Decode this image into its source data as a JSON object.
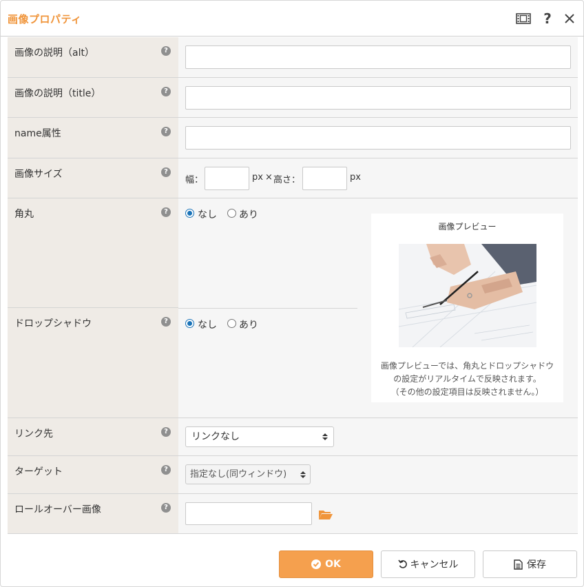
{
  "dialog": {
    "title": "画像プロパティ",
    "icons": [
      "film-icon",
      "help-icon",
      "close-icon"
    ]
  },
  "fields": {
    "alt": {
      "label": "画像の説明（alt）",
      "value": ""
    },
    "title": {
      "label": "画像の説明（title）",
      "value": ""
    },
    "name": {
      "label": "name属性",
      "value": ""
    },
    "size": {
      "label": "画像サイズ",
      "width_label": "幅：",
      "unit1": "px",
      "times": "×",
      "height_label": "高さ：",
      "unit2": "px",
      "width": "",
      "height": ""
    },
    "corner": {
      "label": "角丸",
      "options": [
        "なし",
        "あり"
      ],
      "selected": "なし"
    },
    "shadow": {
      "label": "ドロップシャドウ",
      "options": [
        "なし",
        "あり"
      ],
      "selected": "なし"
    },
    "link": {
      "label": "リンク先",
      "selected": "リンクなし"
    },
    "target": {
      "label": "ターゲット",
      "selected": "指定なし(同ウィンドウ)"
    },
    "rollover": {
      "label": "ロールオーバー画像",
      "value": ""
    }
  },
  "help_glyph": "?",
  "preview": {
    "title": "画像プレビュー",
    "note_line1": "画像プレビューでは、角丸とドロップシャドウ",
    "note_line2": "の設定がリアルタイムで反映されます。",
    "note_line3": "（その他の設定項目は反映されません。）"
  },
  "buttons": {
    "ok": "OK",
    "cancel": "キャンセル",
    "save": "保存"
  },
  "colors": {
    "accent": "#f0953b",
    "ok_bg": "#f5a04e",
    "label_bg": "#efebe6",
    "value_bg": "#f6f6f6",
    "folder": "#f0953b",
    "radio_on": "#1a73b8"
  }
}
